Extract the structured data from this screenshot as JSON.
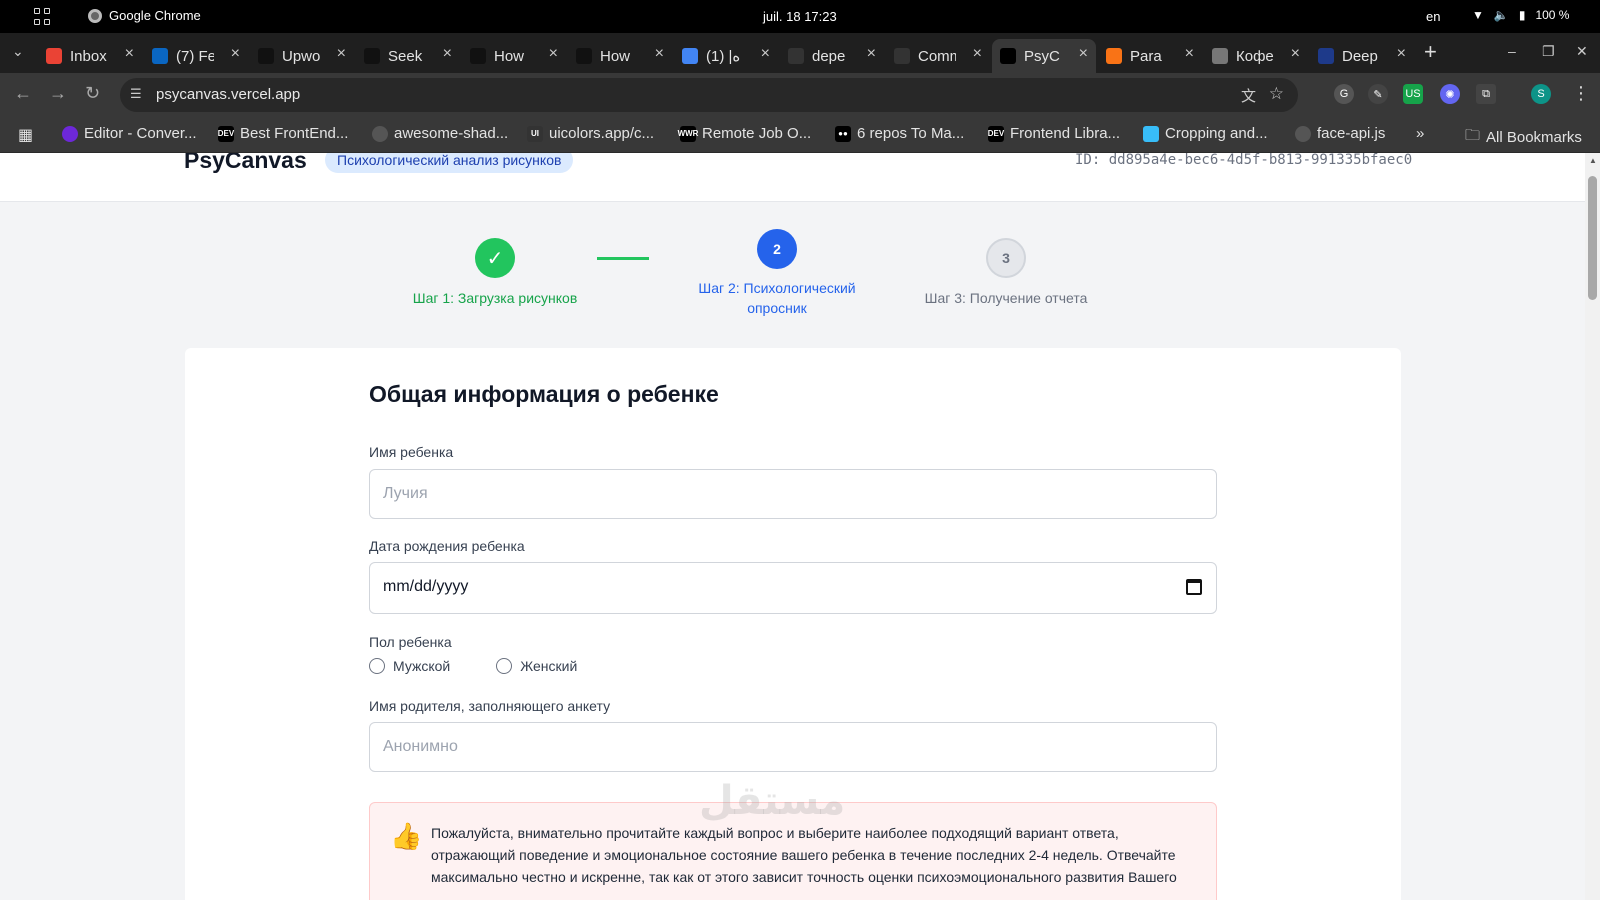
{
  "os": {
    "app_name": "Google Chrome",
    "clock": "juil. 18  17:23",
    "lang": "en",
    "battery": "100 %"
  },
  "tabs": [
    {
      "title": "Inbox",
      "icon": "gmail-icon",
      "color": "#ea4335"
    },
    {
      "title": "(7) Fe",
      "icon": "linkedin-icon",
      "color": "#0a66c2"
    },
    {
      "title": "Upwo",
      "icon": "upwork-icon",
      "color": "#111111"
    },
    {
      "title": "Seek",
      "icon": "upwork-icon",
      "color": "#111111"
    },
    {
      "title": "How",
      "icon": "upwork-icon",
      "color": "#111111"
    },
    {
      "title": "How",
      "icon": "upwork-icon",
      "color": "#111111"
    },
    {
      "title": "ه| (1)",
      "icon": "google-icon",
      "color": "#4285f4"
    },
    {
      "title": "depe",
      "icon": "mask-icon",
      "color": "#333333"
    },
    {
      "title": "Comm",
      "icon": "github-icon",
      "color": "#333333"
    },
    {
      "title": "PsyC",
      "icon": "vercel-icon",
      "color": "#000000"
    },
    {
      "title": "Para",
      "icon": "flame-icon",
      "color": "#f97316"
    },
    {
      "title": "Кофе",
      "icon": "globe-icon",
      "color": "#777777"
    },
    {
      "title": "Deep",
      "icon": "terminal-icon",
      "color": "#1e3a8a"
    }
  ],
  "address": {
    "url": "psycanvas.vercel.app"
  },
  "bookmarks": [
    {
      "label": "Editor - Conver...",
      "icon": "circle-icon",
      "color": "#6d28d9"
    },
    {
      "label": "Best FrontEnd...",
      "icon": "dev-icon",
      "color": "#000000",
      "abbr": "DEV"
    },
    {
      "label": "awesome-shad...",
      "icon": "globe-icon",
      "color": "#555555"
    },
    {
      "label": "uicolors.app/c...",
      "icon": "ui-icon",
      "color": "#333333",
      "abbr": "UI"
    },
    {
      "label": "Remote Job O...",
      "icon": "wwr-icon",
      "color": "#000000",
      "abbr": "WWR"
    },
    {
      "label": "6 repos To Ma...",
      "icon": "medium-icon",
      "color": "#000000",
      "abbr": "●●"
    },
    {
      "label": "Frontend Libra...",
      "icon": "dev-icon",
      "color": "#000000",
      "abbr": "DEV"
    },
    {
      "label": "Cropping and...",
      "icon": "tailwind-icon",
      "color": "#38bdf8"
    },
    {
      "label": "face-api.js",
      "icon": "globe-icon",
      "color": "#555555"
    }
  ],
  "bookmarks_all": "All Bookmarks",
  "app": {
    "brand": "PsyCanvas",
    "badge": "Психологический анализ рисунков",
    "session_id": "ID: dd895a4e-bec6-4d5f-b813-991335bfaec0"
  },
  "steps": [
    {
      "label": "Шаг 1: Загрузка рисунков",
      "state": "done"
    },
    {
      "number": "2",
      "label_line1": "Шаг 2: Психологический",
      "label_line2": "опросник",
      "state": "active"
    },
    {
      "number": "3",
      "label": "Шаг 3: Получение отчета",
      "state": "pending"
    }
  ],
  "form": {
    "title": "Общая информация о ребенке",
    "child_name_label": "Имя ребенка",
    "child_name_placeholder": "Лучия",
    "dob_label": "Дата рождения ребенка",
    "dob_value": "mm/dd/yyyy",
    "gender_label": "Пол ребенка",
    "gender_male": "Мужской",
    "gender_female": "Женский",
    "parent_label": "Имя родителя, заполняющего анкету",
    "parent_placeholder": "Анонимно",
    "notice": "Пожалуйста, внимательно прочитайте каждый вопрос и выберите наиболее подходящий вариант ответа, отражающий поведение и эмоциональное состояние вашего ребенка в течение последних 2-4 недель. Отвечайте максимально честно и искренне, так как от этого зависит точность оценки психоэмоционального развития Вашего"
  },
  "watermark": "مستقل",
  "colors": {
    "success": "#22c55e",
    "primary": "#2563eb",
    "pending": "#e5e7eb"
  }
}
